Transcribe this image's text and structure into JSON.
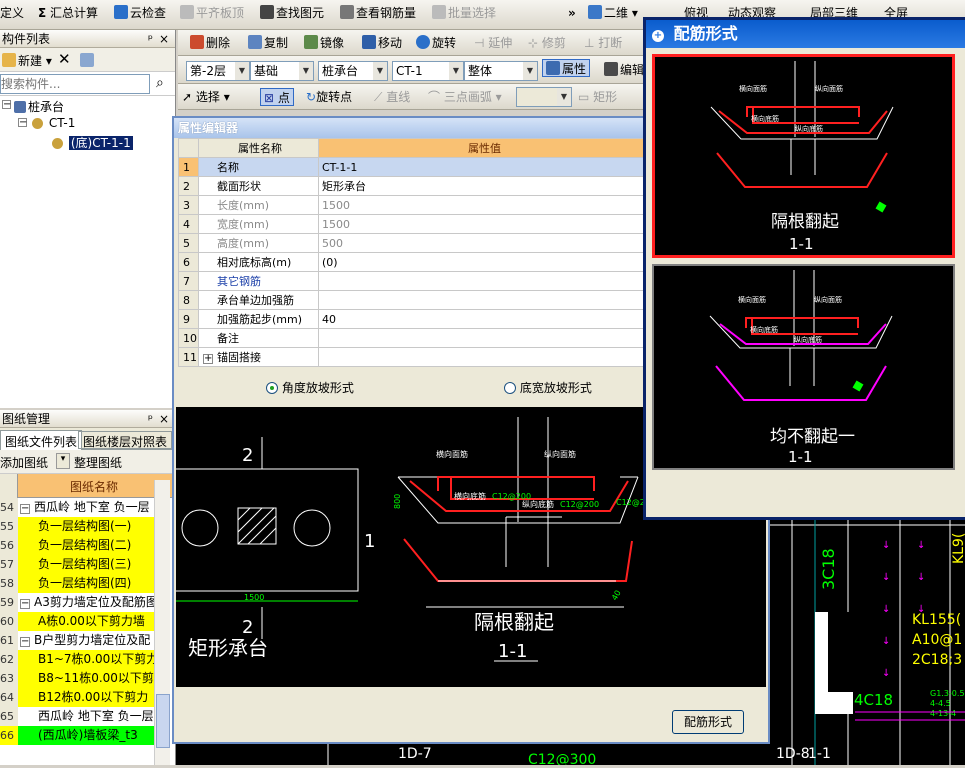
{
  "menu": {
    "items": [
      "定义",
      "汇总计算",
      "云检查",
      "平齐板顶",
      "查找图元",
      "查看钢筋量",
      "批量选择"
    ],
    "more": "»",
    "view_mode": "二维",
    "partial_1": "俯视",
    "partial_2": "动态观察",
    "partial_3": "局部三维",
    "partial_4": "全屏"
  },
  "component_list": {
    "title": "构件列表",
    "pin": "ᵖ",
    "close": "×",
    "new_label": "新建",
    "search_placeholder": "搜索构件...",
    "tree": {
      "root": "桩承台",
      "child": "CT-1",
      "leaf": "(底)CT-1-1"
    }
  },
  "edit_toolbar": {
    "delete": "删除",
    "copy": "复制",
    "mirror": "镜像",
    "move": "移动",
    "rotate": "旋转",
    "extend": "延伸",
    "trim": "修剪",
    "break": "打断"
  },
  "layer_bar": {
    "floor": "第-2层",
    "category": "基础",
    "type": "桩承台",
    "component": "CT-1",
    "mode": "整体",
    "attr_button": "属性",
    "edit_button": "编辑"
  },
  "draw_bar": {
    "select": "选择",
    "point": "点",
    "rotate_point": "旋转点",
    "line": "直线",
    "arc": "三点画弧",
    "rect": "矩形"
  },
  "property_editor": {
    "title": "属性编辑器",
    "col_name": "属性名称",
    "col_value": "属性值",
    "rows": [
      {
        "no": "1",
        "name": "名称",
        "value": "CT-1-1"
      },
      {
        "no": "2",
        "name": "截面形状",
        "value": "矩形承台"
      },
      {
        "no": "3",
        "name": "长度(mm)",
        "value": "1500"
      },
      {
        "no": "4",
        "name": "宽度(mm)",
        "value": "1500"
      },
      {
        "no": "5",
        "name": "高度(mm)",
        "value": "500"
      },
      {
        "no": "6",
        "name": "相对底标高(m)",
        "value": "(0)"
      },
      {
        "no": "7",
        "name": "其它钢筋",
        "value": ""
      },
      {
        "no": "8",
        "name": "承台单边加强筋",
        "value": ""
      },
      {
        "no": "9",
        "name": "加强筋起步(mm)",
        "value": "40"
      },
      {
        "no": "10",
        "name": "备注",
        "value": ""
      },
      {
        "no": "11",
        "name": "锚固搭接",
        "value": ""
      }
    ],
    "radio_angle": "角度放坡形式",
    "radio_width": "底宽放坡形式",
    "preview": {
      "plan_label": "矩形承台",
      "dim_1500": "1500",
      "mark_2_top": "2",
      "mark_2_bottom": "2",
      "mark_1": "1",
      "section_title": "隔根翻起",
      "section_sub": "1-1",
      "lbl_top_h": "横向面筋",
      "lbl_top_v": "纵向面筋",
      "lbl_bot_h": "横向底筋",
      "lbl_bot_v": "纵向底筋",
      "val_bot_h": "C12@200",
      "val_bot_v": "C12@200",
      "val_side": "C12@20",
      "dim_800": "800",
      "dim_small": "40"
    },
    "rebar_button": "配筋形式"
  },
  "drawing_manager": {
    "title": "图纸管理",
    "tab_files": "图纸文件列表",
    "tab_floors": "图纸楼层对照表",
    "add_button": "添加图纸",
    "arrange_button": "整理图纸",
    "col_header": "图纸名称",
    "rows": [
      {
        "no": "54",
        "text": "西瓜岭 地下室 负一层",
        "style": "white",
        "group": true
      },
      {
        "no": "55",
        "text": "负一层结构图(一)",
        "style": "yellow"
      },
      {
        "no": "56",
        "text": "负一层结构图(二)",
        "style": "yellow"
      },
      {
        "no": "57",
        "text": "负一层结构图(三)",
        "style": "yellow"
      },
      {
        "no": "58",
        "text": "负一层结构图(四)",
        "style": "yellow"
      },
      {
        "no": "59",
        "text": "A3剪力墙定位及配筋图",
        "style": "white",
        "group": true
      },
      {
        "no": "60",
        "text": "A栋0.00以下剪力墙",
        "style": "yellow"
      },
      {
        "no": "61",
        "text": "B户型剪力墙定位及配",
        "style": "white",
        "group": true
      },
      {
        "no": "62",
        "text": "B1~7栋0.00以下剪力",
        "style": "yellow"
      },
      {
        "no": "63",
        "text": "B8~11栋0.00以下剪",
        "style": "yellow"
      },
      {
        "no": "64",
        "text": "B12栋0.00以下剪力",
        "style": "yellow"
      },
      {
        "no": "65",
        "text": "西瓜岭 地下室 负一层",
        "style": "white"
      },
      {
        "no": "66",
        "text": "(西瓜岭)墙板梁_t3",
        "style": "green"
      }
    ]
  },
  "rebar_dialog": {
    "title": "配筋形式",
    "option1_title": "隔根翻起",
    "option1_sub": "1-1",
    "option2_title": "均不翻起一",
    "option2_sub": "1-1",
    "lbl_top_h": "横向面筋",
    "lbl_top_v": "纵向面筋",
    "lbl_bot_h": "横向底筋",
    "lbl_bot_v": "纵向底筋"
  },
  "cad_bg": {
    "kl_text_1": "KL155(",
    "kl_text_2": "A10@1",
    "kl_text_3": "2C18;3",
    "kl9": "KL9(",
    "c18_v": "3C18",
    "c18_h": "4C18",
    "bottom_1": "1D-7",
    "bottom_2": "C12@300",
    "bottom_3": "1D-8",
    "bottom_4": "1-1",
    "g_text_1": "G1.3-0.5",
    "g_text_2": "4-4.5",
    "g_text_3": "4-13-4"
  },
  "colors": {
    "selected_row": "#c7d7f0",
    "header_orange": "#f9c173",
    "dialog_blue": "#0a246a",
    "cad_red": "#ff2020",
    "cad_yellow": "#ffff00",
    "cad_green": "#00ff00",
    "cad_magenta": "#ff00ff"
  }
}
